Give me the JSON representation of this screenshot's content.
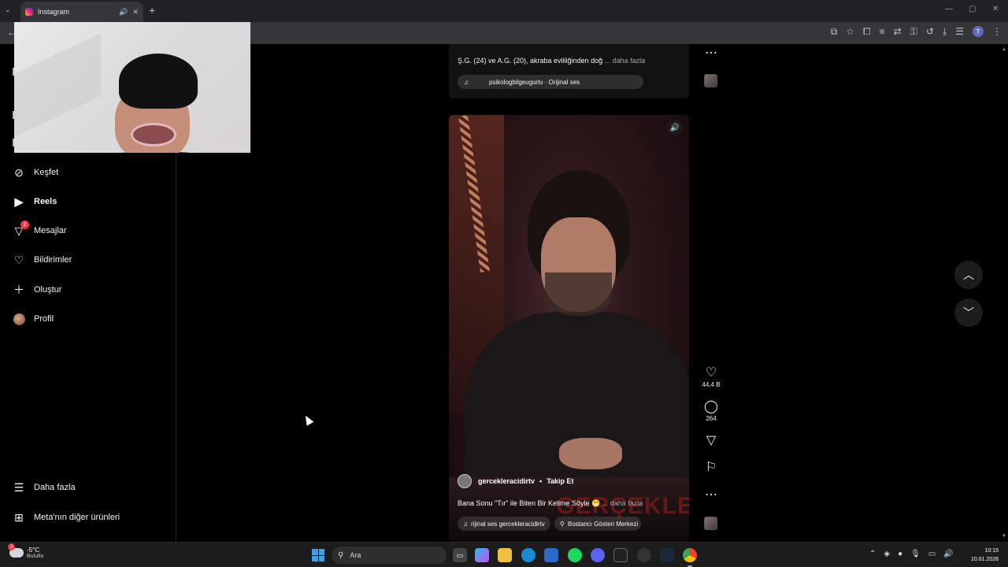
{
  "browser": {
    "tab_title": "Instagram",
    "new_tab_symbol": "+",
    "tab_list_symbol": "⌄",
    "tab_mute_symbol": "🔊",
    "tab_close_symbol": "✕",
    "window_min": "—",
    "window_max": "▢",
    "window_close": "✕",
    "back_symbol": "←",
    "profile_initial": "T"
  },
  "sidebar": {
    "items": [
      {
        "label": "Keşfet",
        "icon": "compass-icon"
      },
      {
        "label": "Reels",
        "icon": "reels-icon"
      },
      {
        "label": "Mesajlar",
        "icon": "messages-icon",
        "badge": "2"
      },
      {
        "label": "Bildirimler",
        "icon": "heart-icon"
      },
      {
        "label": "Oluştur",
        "icon": "plus-icon"
      },
      {
        "label": "Profil",
        "icon": "avatar"
      }
    ],
    "bottom": [
      {
        "label": "Daha fazla",
        "icon": "menu-icon"
      },
      {
        "label": "Meta'nın diğer ürünleri",
        "icon": "meta-apps-icon"
      }
    ]
  },
  "prev_post": {
    "caption": "Ş.G. (24) ve A.G. (20), akraba evliliğinden doğ",
    "more": "... daha fazla",
    "audio": "psikologbilgeugurlu · Orijinal ses"
  },
  "post": {
    "username": "gercekleracidirtv",
    "separator": "•",
    "follow": "Takip Et",
    "caption": "Bana Sonu \"Tır\" ile Biten Bir Kelime Söyle 😁",
    "more": "... daha fazla",
    "audio": "rijinal ses  gercekleracidirtv",
    "location": "Bostancı Gösteri Merkezi",
    "stage_text": "GERÇEKLE",
    "likes": "44,4 B",
    "comments": "264"
  },
  "taskbar": {
    "weather_temp": "-5°C",
    "weather_desc": "Bulutlu",
    "weather_badge": "3",
    "search_placeholder": "Ara",
    "time": "10:15",
    "date": "10.01.2026"
  },
  "colors": {
    "background": "#000000",
    "badge": "#ff3040",
    "accent": "#3aa0f0"
  }
}
